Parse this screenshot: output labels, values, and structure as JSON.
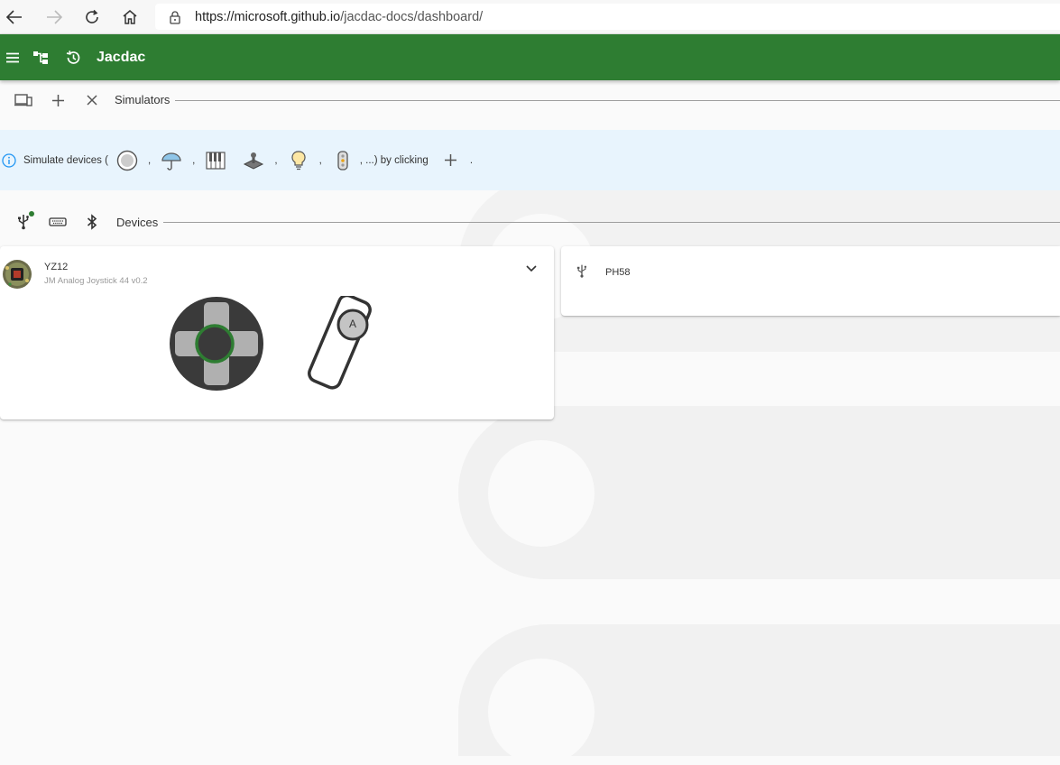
{
  "browser": {
    "url_host": "https://microsoft.github.io",
    "url_path": "/jacdac-docs/dashboard/"
  },
  "appbar": {
    "title": "Jacdac",
    "color": "#2e7d32"
  },
  "simulators": {
    "label": "Simulators"
  },
  "info": {
    "prefix": "Simulate devices (",
    "comma": ",",
    "suffix": ", ...) by clicking",
    "end": ".",
    "icons": [
      "button-icon",
      "umbrella-icon",
      "piano-icon",
      "joystick-icon",
      "lightbulb-icon",
      "traffic-light-icon"
    ]
  },
  "devices": {
    "label": "Devices",
    "cards": [
      {
        "name": "YZ12",
        "description": "JM Analog Joystick 44 v0.2",
        "button_label": "A"
      },
      {
        "name": "PH58"
      }
    ]
  }
}
